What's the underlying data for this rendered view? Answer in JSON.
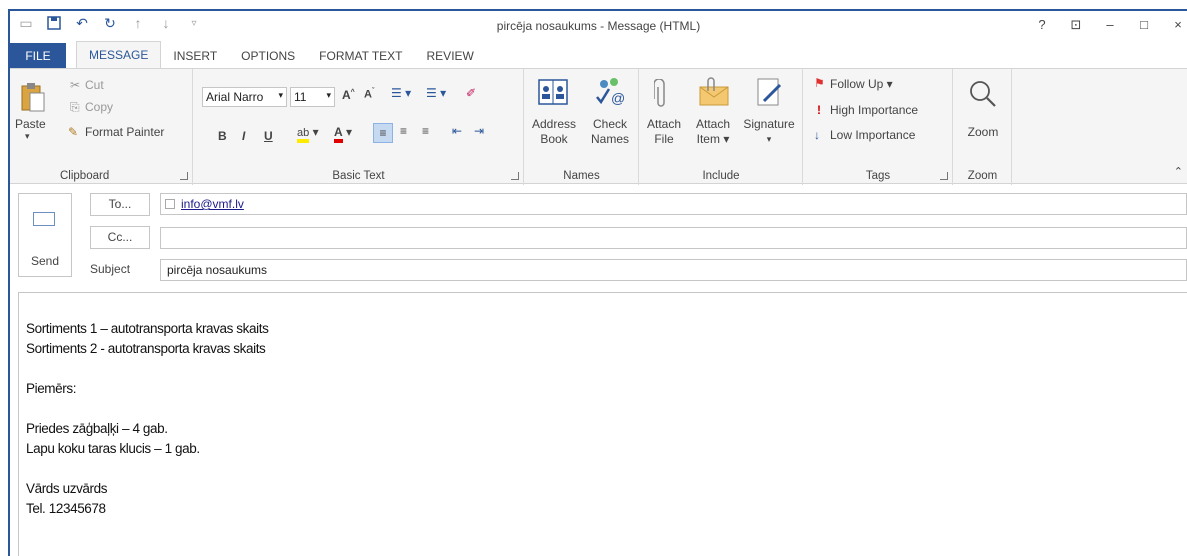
{
  "window": {
    "title": "pircēja nosaukums - Message (HTML)",
    "controls": [
      "?",
      "⊡",
      "–",
      "□",
      "×"
    ]
  },
  "tabs": [
    "FILE",
    "MESSAGE",
    "INSERT",
    "OPTIONS",
    "FORMAT TEXT",
    "REVIEW"
  ],
  "ribbon": {
    "clipboard": {
      "label": "Clipboard",
      "paste": "Paste",
      "cut": "Cut",
      "copy": "Copy",
      "format_painter": "Format Painter"
    },
    "basic_text": {
      "label": "Basic Text",
      "font": "Arial Narro",
      "size": "11",
      "bold": "B",
      "italic": "I",
      "underline": "U"
    },
    "names": {
      "label": "Names",
      "address_book": [
        "Address",
        "Book"
      ],
      "check_names": [
        "Check",
        "Names"
      ]
    },
    "include": {
      "label": "Include",
      "attach_file": [
        "Attach",
        "File"
      ],
      "attach_item": [
        "Attach",
        "Item ▾"
      ],
      "signature": "Signature"
    },
    "tags": {
      "label": "Tags",
      "follow_up": "Follow Up ▾",
      "high_importance": "High Importance",
      "low_importance": "Low Importance"
    },
    "zoom": {
      "label": "Zoom",
      "zoom": "Zoom"
    }
  },
  "compose": {
    "send": "Send",
    "to_button": "To...",
    "cc_button": "Cc...",
    "subject_label": "Subject",
    "to_value": "info@vmf.lv",
    "cc_value": "",
    "subject_value": "pircēja nosaukums"
  },
  "body_lines": [
    "Sortiments 1 – autotransporta kravas skaits",
    "Sortiments 2 - autotransporta kravas skaits",
    "",
    "Piemērs:",
    "",
    "Priedes zāģbaļķi – 4 gab.",
    "Lapu koku taras klucis – 1 gab.",
    "",
    "Vārds uzvārds",
    "Tel. 12345678"
  ],
  "colors": {
    "accent": "#2b579a",
    "ribbon_bg": "#f5f5f5",
    "follow_up_flag": "#e03030",
    "high_importance": "#d00000",
    "low_importance": "#2b579a"
  }
}
